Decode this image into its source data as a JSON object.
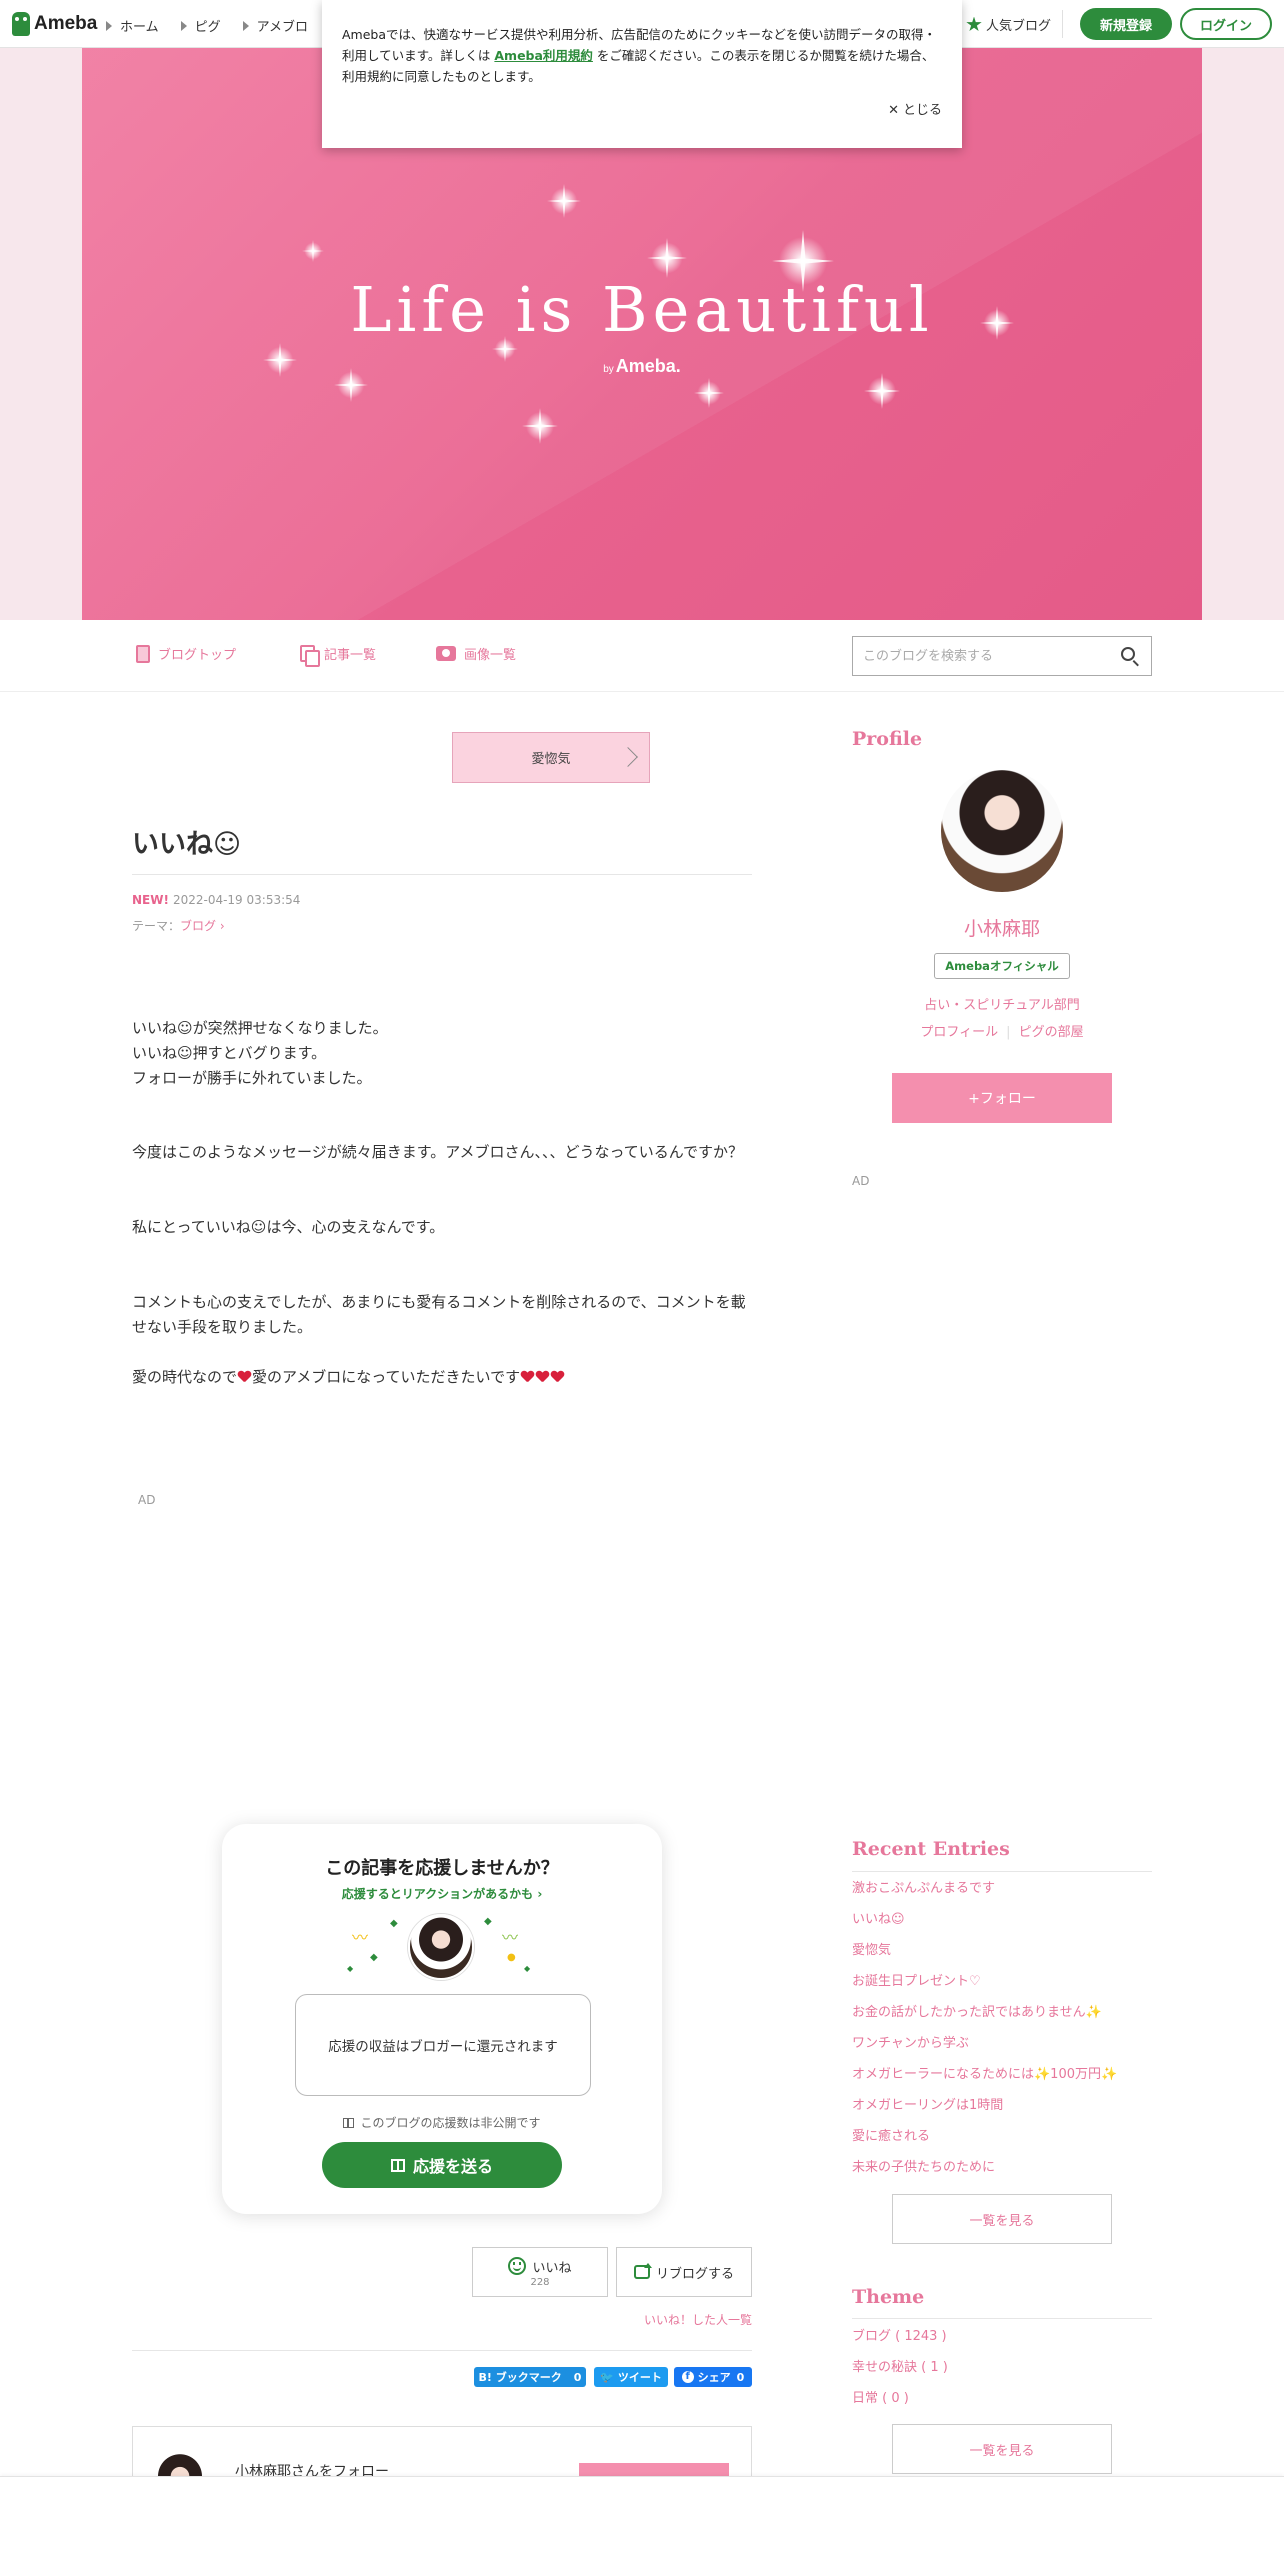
{
  "header": {
    "logo": "Ameba",
    "nav": [
      "ホーム",
      "ピグ",
      "アメブロ"
    ],
    "popular": "人気ブログ",
    "register": "新規登録",
    "login": "ログイン"
  },
  "cookie": {
    "text_before": "Amebaでは、快適なサービス提供や利用分析、広告配信のためにクッキーなどを使い訪問データの取得・利用しています。詳しくは",
    "link": "Ameba利用規約",
    "text_after": "をご確認ください。この表示を閉じるか閲覧を続けた場合、利用規約に同意したものとします。",
    "close": "とじる"
  },
  "hero": {
    "title": "Life is Beautiful",
    "by": "by",
    "brand": "Ameba."
  },
  "blog_nav": {
    "top": "ブログトップ",
    "entries": "記事一覧",
    "images": "画像一覧",
    "search_placeholder": "このブログを検索する"
  },
  "entry": {
    "theme_badge": "愛惚気",
    "title": "いいね☺︎",
    "new_label": "NEW!",
    "datetime": "2022-04-19 03:53:54",
    "theme_label": "テーマ：",
    "theme": "ブログ",
    "p1": [
      "いいね☺︎が突然押せなくなりました。",
      "いいね☺︎押すとバグります。",
      "フォローが勝手に外れていました。"
    ],
    "p2": "今度はこのようなメッセージが続々届きます。アメブロさん、、、どうなっているんですか？",
    "p3": "私にとっていいね☺︎は今、心の支えなんです。",
    "p4": "コメントも心の支えでしたが、あまりにも愛有るコメントを削除されるので、コメントを載せない手段を取りました。",
    "p5_a": "愛の時代なので",
    "p5_b": "愛のアメブロになっていただきたいです",
    "ad": "AD"
  },
  "support": {
    "title": "この記事を応援しませんか？",
    "subtitle": "応援するとリアクションがあるかも",
    "box": "応援の収益はブロガーに還元されます",
    "note": "このブログの応援数は非公開です",
    "button": "応援を送る"
  },
  "reactions": {
    "like": "いいね",
    "like_count": "228",
    "reblog": "リブログする",
    "liked_list": "いいね！した人一覧"
  },
  "share": {
    "hatena": "B! ブックマーク",
    "hatena_count": "0",
    "tweet": "ツイート",
    "facebook": "シェア",
    "facebook_count": "0"
  },
  "follow_card": {
    "text": "小林麻耶さんをフォロー"
  },
  "sidebar": {
    "profile_heading": "Profile",
    "name": "小林麻耶",
    "official": "Amebaオフィシャル",
    "category": "占い・スピリチュアル部門",
    "profile_link": "プロフィール",
    "pig_link": "ピグの部屋",
    "follow": "+フォロー",
    "ad": "AD",
    "recent_heading": "Recent Entries",
    "recent": [
      "激おこぷんぷんまるです",
      "いいね☺︎",
      "愛惚気",
      "お誕生日プレゼント♡",
      "お金の話がしたかった訳ではありません✨",
      "ワンチャンから学ぶ",
      "オメガヒーラーになるためには✨100万円✨",
      "オメガヒーリングは1時間",
      "愛に癒される",
      "未来の子供たちのために"
    ],
    "more": "一覧を見る",
    "theme_heading": "Theme",
    "themes": [
      "ブログ ( 1243 )",
      "幸せの秘訣 ( 1 )",
      "日常 ( 0 )"
    ]
  },
  "colors": {
    "accent_pink": "#e6779b",
    "ameba_green": "#2d8c3c",
    "hero_pink": "#ea6591"
  }
}
